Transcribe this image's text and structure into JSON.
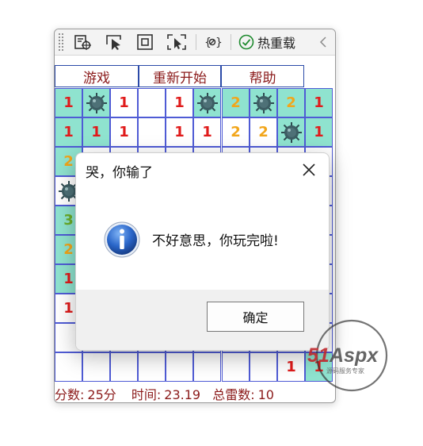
{
  "toolbar": {
    "tools": [
      {
        "icon": "select-element-icon"
      },
      {
        "icon": "pointer-select-icon"
      },
      {
        "icon": "layout-adorner-icon"
      },
      {
        "icon": "track-focus-icon"
      },
      {
        "icon": "binding-failures-icon"
      }
    ],
    "hot_reload_label": "热重载",
    "hot_reload_icon": "checkmark-circle-icon",
    "collapse_icon": "chevron-left-icon"
  },
  "menu": {
    "game": "游戏",
    "restart": "重新开始",
    "help": "帮助"
  },
  "board": {
    "colors": {
      "one": "#e01b1b",
      "two": "#f2a61b",
      "three": "#6aae2a",
      "open": "#ffffff",
      "covered": "#8fe3cf",
      "grid": "#4f5bd5"
    },
    "rows": [
      [
        {
          "t": "teal",
          "v": "1"
        },
        {
          "t": "teal",
          "m": true
        },
        {
          "t": "open",
          "v": "1"
        },
        {
          "t": "open",
          "v": ""
        },
        {
          "t": "open",
          "v": "1"
        },
        {
          "t": "teal",
          "m": true
        },
        {
          "t": "teal",
          "v": "2"
        },
        {
          "t": "teal",
          "m": true
        },
        {
          "t": "teal",
          "v": "2"
        },
        {
          "t": "teal",
          "v": "1"
        }
      ],
      [
        {
          "t": "teal",
          "v": "1"
        },
        {
          "t": "teal",
          "v": "1"
        },
        {
          "t": "open",
          "v": "1"
        },
        {
          "t": "open",
          "v": ""
        },
        {
          "t": "open",
          "v": "1"
        },
        {
          "t": "open",
          "v": "1"
        },
        {
          "t": "open",
          "v": "2"
        },
        {
          "t": "open",
          "v": "2"
        },
        {
          "t": "teal",
          "m": true
        },
        {
          "t": "teal",
          "v": "1"
        }
      ],
      [
        {
          "t": "teal",
          "v": "2"
        },
        {
          "t": "open",
          "v": ""
        },
        {
          "t": "open",
          "v": ""
        },
        {
          "t": "open",
          "v": ""
        },
        {
          "t": "open",
          "v": ""
        },
        {
          "t": "open",
          "v": ""
        },
        {
          "t": "open",
          "v": ""
        },
        {
          "t": "open",
          "v": ""
        },
        {
          "t": "open",
          "v": ""
        },
        {
          "t": "open",
          "v": ""
        }
      ],
      [
        {
          "t": "open",
          "m": true
        },
        {
          "t": "open",
          "v": ""
        },
        {
          "t": "open",
          "v": ""
        },
        {
          "t": "open",
          "v": ""
        },
        {
          "t": "open",
          "v": ""
        },
        {
          "t": "open",
          "v": ""
        },
        {
          "t": "open",
          "v": ""
        },
        {
          "t": "open",
          "v": ""
        },
        {
          "t": "open",
          "v": ""
        },
        {
          "t": "open",
          "v": ""
        }
      ],
      [
        {
          "t": "teal",
          "v": "3"
        },
        {
          "t": "open",
          "v": ""
        },
        {
          "t": "open",
          "v": ""
        },
        {
          "t": "open",
          "v": ""
        },
        {
          "t": "open",
          "v": ""
        },
        {
          "t": "open",
          "v": ""
        },
        {
          "t": "open",
          "v": ""
        },
        {
          "t": "open",
          "v": ""
        },
        {
          "t": "open",
          "v": ""
        },
        {
          "t": "open",
          "v": ""
        }
      ],
      [
        {
          "t": "teal",
          "v": "2"
        },
        {
          "t": "open",
          "v": ""
        },
        {
          "t": "open",
          "v": ""
        },
        {
          "t": "open",
          "v": ""
        },
        {
          "t": "open",
          "v": ""
        },
        {
          "t": "open",
          "v": ""
        },
        {
          "t": "open",
          "v": ""
        },
        {
          "t": "open",
          "v": ""
        },
        {
          "t": "open",
          "v": ""
        },
        {
          "t": "open",
          "v": ""
        }
      ],
      [
        {
          "t": "teal",
          "v": "1"
        },
        {
          "t": "open",
          "v": ""
        },
        {
          "t": "open",
          "v": ""
        },
        {
          "t": "open",
          "v": ""
        },
        {
          "t": "open",
          "v": ""
        },
        {
          "t": "open",
          "v": ""
        },
        {
          "t": "open",
          "v": ""
        },
        {
          "t": "open",
          "v": ""
        },
        {
          "t": "open",
          "v": ""
        },
        {
          "t": "open",
          "v": ""
        }
      ],
      [
        {
          "t": "open",
          "v": "1"
        },
        {
          "t": "open",
          "v": ""
        },
        {
          "t": "open",
          "v": ""
        },
        {
          "t": "open",
          "v": ""
        },
        {
          "t": "open",
          "v": ""
        },
        {
          "t": "open",
          "v": ""
        },
        {
          "t": "open",
          "v": ""
        },
        {
          "t": "open",
          "v": ""
        },
        {
          "t": "open",
          "v": ""
        },
        {
          "t": "open",
          "v": ""
        }
      ],
      [
        {
          "t": "open",
          "v": ""
        },
        {
          "t": "open",
          "v": ""
        },
        {
          "t": "open",
          "v": ""
        },
        {
          "t": "open",
          "v": ""
        },
        {
          "t": "open",
          "v": ""
        },
        {
          "t": "open",
          "v": ""
        },
        {
          "t": "open",
          "v": ""
        },
        {
          "t": "open",
          "v": ""
        },
        {
          "t": "open",
          "v": ""
        },
        {
          "t": "open",
          "v": ""
        }
      ],
      [
        {
          "t": "open",
          "v": ""
        },
        {
          "t": "open",
          "v": ""
        },
        {
          "t": "open",
          "v": ""
        },
        {
          "t": "open",
          "v": ""
        },
        {
          "t": "open",
          "v": ""
        },
        {
          "t": "open",
          "v": ""
        },
        {
          "t": "open",
          "v": ""
        },
        {
          "t": "open",
          "v": ""
        },
        {
          "t": "open",
          "v": "1"
        },
        {
          "t": "teal",
          "v": "1"
        }
      ]
    ]
  },
  "status": {
    "score_label": "分数:",
    "score_value": "25分",
    "time_label": "时间:",
    "time_value": "23.19",
    "mines_label": "总雷数:",
    "mines_value": "10"
  },
  "dialog": {
    "title": "哭，你输了",
    "message": "不好意思，你玩完啦!",
    "ok_label": "确定",
    "icon": "information-icon",
    "close_icon": "close-icon"
  },
  "watermark": {
    "brand": "51Aspx",
    "tagline": "源码服务专家"
  }
}
